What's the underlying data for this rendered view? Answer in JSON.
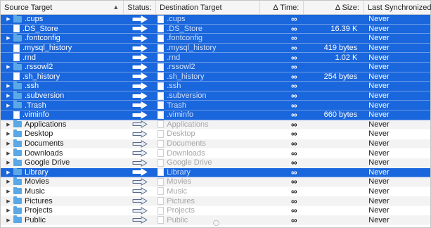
{
  "columns": {
    "source": "Source Target",
    "status": "Status:",
    "destination": "Destination Target",
    "delta_time": "Δ Time:",
    "delta_size": "Δ Size:",
    "last_sync": "Last Synchronized:"
  },
  "colors": {
    "selection": "#1a66dc",
    "folder": "#5aa9e6"
  },
  "rows": [
    {
      "name": ".cups",
      "dest": ".cups",
      "type": "folder",
      "expandable": true,
      "selected": true,
      "time": "∞",
      "size": "",
      "sync": "Never"
    },
    {
      "name": ".DS_Store",
      "dest": ".DS_Store",
      "type": "file",
      "expandable": false,
      "selected": true,
      "time": "∞",
      "size": "16.39 K",
      "sync": "Never"
    },
    {
      "name": ".fontconfig",
      "dest": ".fontconfig",
      "type": "folder",
      "expandable": true,
      "selected": true,
      "time": "∞",
      "size": "",
      "sync": "Never"
    },
    {
      "name": ".mysql_history",
      "dest": ".mysql_history",
      "type": "file",
      "expandable": false,
      "selected": true,
      "time": "∞",
      "size": "419 bytes",
      "sync": "Never"
    },
    {
      "name": ".rnd",
      "dest": ".rnd",
      "type": "file",
      "expandable": false,
      "selected": true,
      "time": "∞",
      "size": "1.02 K",
      "sync": "Never"
    },
    {
      "name": ".rssowl2",
      "dest": ".rssowl2",
      "type": "folder",
      "expandable": true,
      "selected": true,
      "time": "∞",
      "size": "",
      "sync": "Never"
    },
    {
      "name": ".sh_history",
      "dest": ".sh_history",
      "type": "file",
      "expandable": false,
      "selected": true,
      "time": "∞",
      "size": "254 bytes",
      "sync": "Never"
    },
    {
      "name": ".ssh",
      "dest": ".ssh",
      "type": "folder",
      "expandable": true,
      "selected": true,
      "time": "∞",
      "size": "",
      "sync": "Never"
    },
    {
      "name": ".subversion",
      "dest": ".subversion",
      "type": "folder",
      "expandable": true,
      "selected": true,
      "time": "∞",
      "size": "",
      "sync": "Never"
    },
    {
      "name": ".Trash",
      "dest": "Trash",
      "type": "folder",
      "expandable": true,
      "selected": true,
      "time": "∞",
      "size": "",
      "sync": "Never"
    },
    {
      "name": ".viminfo",
      "dest": ".viminfo",
      "type": "file",
      "expandable": false,
      "selected": true,
      "time": "∞",
      "size": "660 bytes",
      "sync": "Never"
    },
    {
      "name": "Applications",
      "dest": "Applications",
      "type": "folder",
      "expandable": true,
      "selected": false,
      "time": "∞",
      "size": "",
      "sync": "Never"
    },
    {
      "name": "Desktop",
      "dest": "Desktop",
      "type": "folder",
      "expandable": true,
      "selected": false,
      "time": "∞",
      "size": "",
      "sync": "Never"
    },
    {
      "name": "Documents",
      "dest": "Documents",
      "type": "folder",
      "expandable": true,
      "selected": false,
      "time": "∞",
      "size": "",
      "sync": "Never"
    },
    {
      "name": "Downloads",
      "dest": "Downloads",
      "type": "folder",
      "expandable": true,
      "selected": false,
      "time": "∞",
      "size": "",
      "sync": "Never"
    },
    {
      "name": "Google Drive",
      "dest": "Google Drive",
      "type": "folder",
      "expandable": true,
      "selected": false,
      "time": "∞",
      "size": "",
      "sync": "Never"
    },
    {
      "name": "Library",
      "dest": "Library",
      "type": "folder",
      "expandable": true,
      "selected": true,
      "time": "∞",
      "size": "",
      "sync": "Never"
    },
    {
      "name": "Movies",
      "dest": "Movies",
      "type": "folder",
      "expandable": true,
      "selected": false,
      "time": "∞",
      "size": "",
      "sync": "Never"
    },
    {
      "name": "Music",
      "dest": "Music",
      "type": "folder",
      "expandable": true,
      "selected": false,
      "time": "∞",
      "size": "",
      "sync": "Never"
    },
    {
      "name": "Pictures",
      "dest": "Pictures",
      "type": "folder",
      "expandable": true,
      "selected": false,
      "time": "∞",
      "size": "",
      "sync": "Never"
    },
    {
      "name": "Projects",
      "dest": "Projects",
      "type": "folder",
      "expandable": true,
      "selected": false,
      "time": "∞",
      "size": "",
      "sync": "Never"
    },
    {
      "name": "Public",
      "dest": "Public",
      "type": "folder",
      "expandable": true,
      "selected": false,
      "time": "∞",
      "size": "",
      "sync": "Never"
    }
  ]
}
